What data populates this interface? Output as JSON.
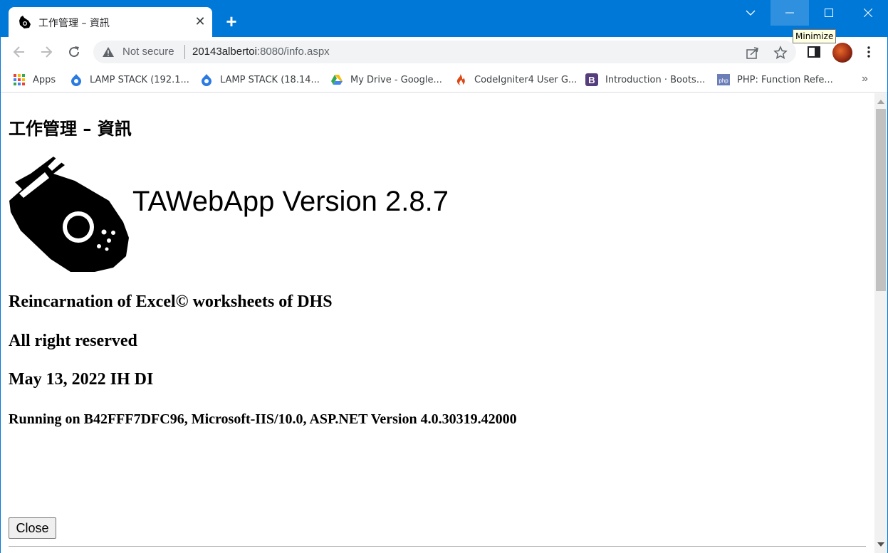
{
  "browser": {
    "tab": {
      "title": "工作管理 – 資訊",
      "close_glyph": "✕",
      "favicon_icon": "falcon-icon"
    },
    "new_tab_glyph": "+",
    "window_controls": {
      "tabsearch_glyph": "⌄",
      "minimize_glyph": "–",
      "maximize_glyph": "☐",
      "close_glyph": "✕"
    },
    "tooltip": "Minimize",
    "omnibox": {
      "security_label": "Not secure",
      "url_host": "20143albertoi",
      "url_path": ":8080/info.aspx"
    },
    "bookmarks": [
      {
        "label": "Apps",
        "icon": "apps-grid-icon"
      },
      {
        "label": "LAMP STACK (192.1...",
        "icon": "drupal-icon"
      },
      {
        "label": "LAMP STACK (18.14...",
        "icon": "drupal-icon"
      },
      {
        "label": "My Drive - Google...",
        "icon": "google-drive-icon"
      },
      {
        "label": "CodeIgniter4 User G...",
        "icon": "codeigniter-icon"
      },
      {
        "label": "Introduction · Boots...",
        "icon": "bootstrap-icon"
      },
      {
        "label": "PHP: Function Refe...",
        "icon": "php-icon"
      }
    ],
    "bookmarks_more": "»"
  },
  "page": {
    "title": "工作管理 – 資訊",
    "app_version": "TAWebApp Version 2.8.7",
    "description": "Reincarnation of Excel© worksheets of DHS",
    "rights": "All right reserved",
    "release": "May 13, 2022 IH DI",
    "runtime": "Running on B42FFF7DFC96, Microsoft-IIS/10.0, ASP.NET Version 4.0.30319.42000",
    "close_button": "Close"
  },
  "colors": {
    "titlebar": "#0078d7",
    "omnibox_bg": "#f1f3f4"
  }
}
